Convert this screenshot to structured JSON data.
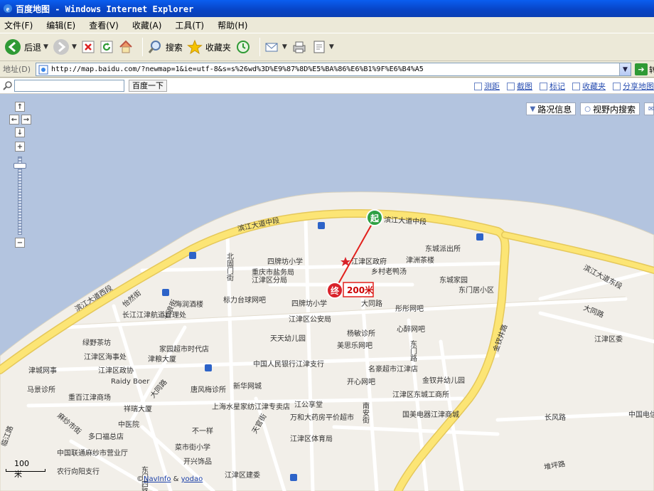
{
  "window": {
    "title": "百度地图 - Windows Internet Explorer"
  },
  "menu": [
    "文件(F)",
    "编辑(E)",
    "查看(V)",
    "收藏(A)",
    "工具(T)",
    "帮助(H)"
  ],
  "toolbar": {
    "back": "后退",
    "search": "搜索",
    "favorites": "收藏夹"
  },
  "address": {
    "label": "地址(D)",
    "url": "http://map.baidu.com/?newmap=1&ie=utf-8&s=s%26wd%3D%E9%87%8D%E5%BA%86%E6%B1%9F%E6%B4%A5",
    "go": "转"
  },
  "search": {
    "button": "百度一下",
    "value": ""
  },
  "tools": [
    "测距",
    "截图",
    "标记",
    "收藏夹",
    "分享地图"
  ],
  "map_tools": [
    "路况信息",
    "视野内搜索"
  ],
  "distance_label": "200米",
  "markers": {
    "start": "起",
    "end": "终"
  },
  "scale": "100米",
  "copyright": {
    "link1": "NavInfo",
    "amp": "&",
    "link2": "yodao"
  },
  "roads": {
    "binjiang_mid": "滨江大道中段",
    "binjiang_mid2": "滨江大道中段",
    "binjiang_west": "滨江大道西段",
    "binjiang_east": "滨江大道东段",
    "datong": "大同路",
    "datong2": "大同路",
    "datong3": "大同路",
    "beiguomen": "北固门街",
    "yisheng": "怡然街",
    "qiliuzhi": "七浪街",
    "dongmen": "东门路",
    "nanan": "南安街",
    "tianguan": "天官街",
    "jinchai": "金钗井路",
    "changfeng": "长风路",
    "maisha": "麻纱市街",
    "linjiang": "临江路",
    "duopo": "堆坪路",
    "dongsan": "东门四路"
  },
  "pois": {
    "dongcheng_police": "东城派出所",
    "sipaifang_primary": "四牌坊小学",
    "jiangjin_gov": "江津区政府",
    "jinzhou_tea": "津洲茶楼",
    "chongqing_tax": "重庆市盐务局",
    "jiangjin_branch": "江津区分局",
    "village_duck": "乡村老鸭汤",
    "dongcheng_home": "东城家园",
    "dongmenju": "东门居小区",
    "haiyun_hotel": "海润酒楼",
    "biaozhun_tennis": "标力台球网吧",
    "sipaifang_primary2": "四牌坊小学",
    "binxing_cafe": "彤彤网吧",
    "changjiang_water": "长江江津航道管理处",
    "jiangjin_police": "江津区公安局",
    "yangmin_clinic": "杨敏诊所",
    "xinzui": "心醉网吧",
    "lvye_tea": "绿野茶坊",
    "jiating_mall": "家园超市时代店",
    "tiantian_kg": "天天幼儿园",
    "meisile": "美思乐网吧",
    "maritime": "江津区海事处",
    "jinyan_hotel": "津粮大厦",
    "jinjiang_net": "津城网事",
    "jiangjin_law": "江津区政协",
    "bank": "中国人民银行江津支行",
    "mingxiang_mall": "名豪超市江津店",
    "raidy": "Raidy Boer",
    "kaixin": "开心网吧",
    "jinchai_kg": "金钗井幼儿园",
    "mayuan_clinic": "马景诊所",
    "tangfeng": "唐风梅诊所",
    "xinhua_net": "新华网城",
    "chongbai_mall": "重百江津商场",
    "jiang_gong": "江公享堂",
    "jiangjin_east_biz": "江津区东城工商所",
    "xiangrui": "祥瑞大厦",
    "shanghai_shui": "上海水星家纺江津专卖店",
    "wanhe_pharmacy": "万和大药房平价超市",
    "guomei": "国美电器江津商城",
    "tcm": "中医院",
    "buyiyang": "不一样",
    "duokou": "多口福总店",
    "caishi_primary": "菜市街小学",
    "jiangjin_stadium": "江津区体育局",
    "china_unicom": "中国联通麻纱市营业厅",
    "kaixing": "开兴饰品",
    "nongxing": "农行向阳支行",
    "jiangjin_build": "江津区建委",
    "jiangjin_commit": "江津区委",
    "china_telecom": "中国电信风营业"
  },
  "colors": {
    "water": "#b3c4df",
    "land": "#f2efe9",
    "main_road": "#fce575",
    "route": "#e2201c"
  }
}
